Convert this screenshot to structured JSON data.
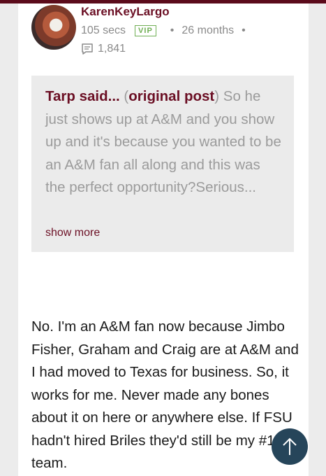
{
  "post": {
    "username": "KarenKeyLargo",
    "time": "105 secs",
    "badge": "VIP",
    "tenure": "26 months",
    "post_count": "1,841"
  },
  "quote": {
    "author": "Tarp said...",
    "open_paren": " (",
    "link_label": "original post",
    "close_paren": ")",
    "text": " So he just shows up at A&M and you show up and it's because you wanted to be an A&M fan all along and this was the perfect opportunity?Serious...",
    "show_more": "show more"
  },
  "reply": {
    "text": "No. I'm an A&M fan now because Jimbo Fisher, Graham and Craig are at A&M and I had moved to Texas for business. So, it works for me. Never made any bones about it on here or anywhere else. If FSU hadn't hired Briles they'd still be my #1 team."
  },
  "colors": {
    "brand": "#6b0f24",
    "vip_green": "#6fae53",
    "fab_bg": "#26455a"
  }
}
